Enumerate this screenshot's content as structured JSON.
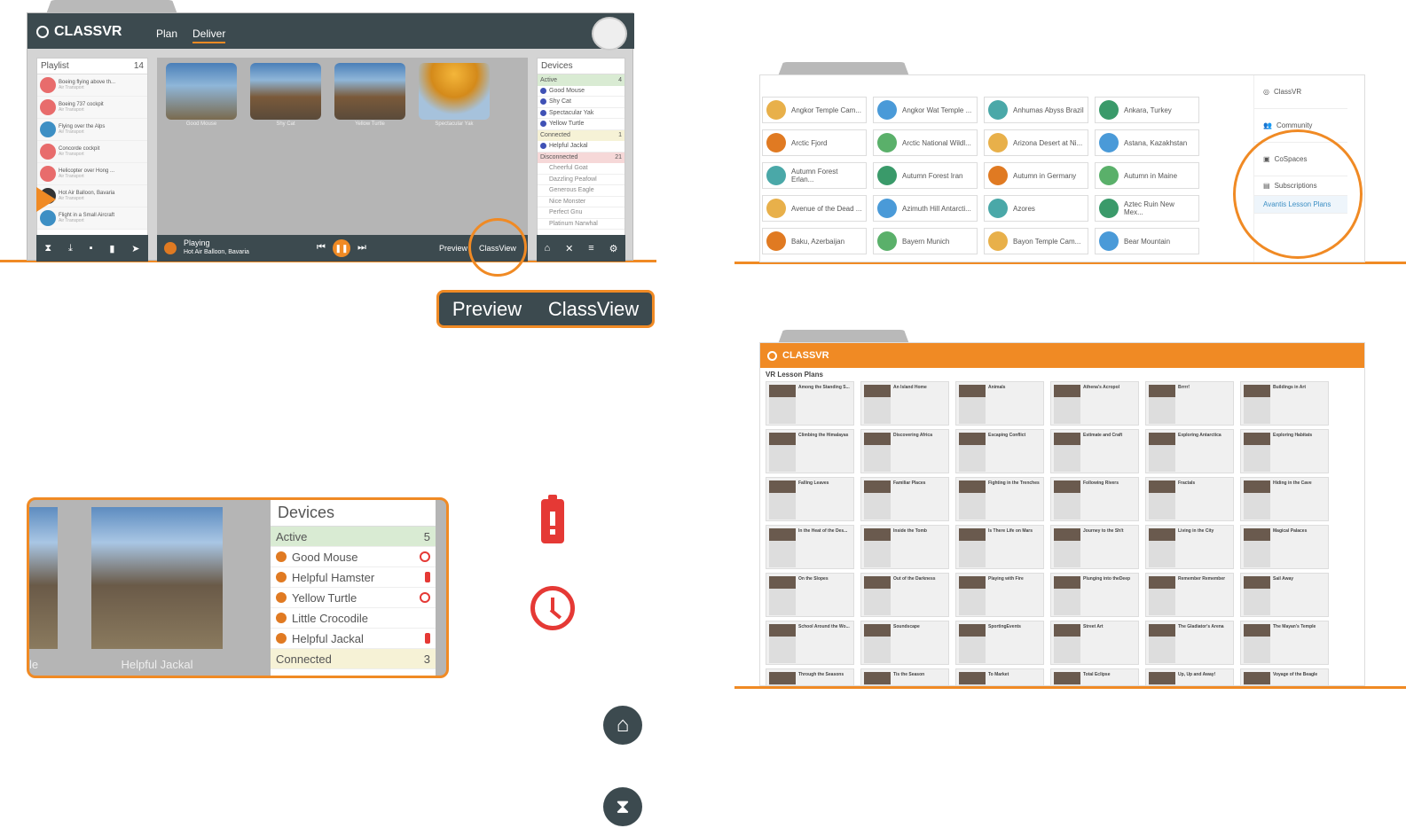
{
  "app": {
    "brand": "CLASSVR",
    "nav": [
      "Plan",
      "Deliver"
    ],
    "accent": "#f08a24",
    "dark": "#3c4a4f"
  },
  "playlist": {
    "title": "Playlist",
    "count": "14",
    "items": [
      {
        "title": "Boeing flying above th...",
        "sub": "Air Transport"
      },
      {
        "title": "Boeing 737 cockpit",
        "sub": "Air Transport"
      },
      {
        "title": "Flying over the Alps",
        "sub": "Air Transport"
      },
      {
        "title": "Concorde cockpit",
        "sub": "Air Transport"
      },
      {
        "title": "Helicopter over Hong ...",
        "sub": "Air Transport"
      },
      {
        "title": "Hot Air Balloon, Bavaria",
        "sub": "Air Transport"
      },
      {
        "title": "Flight in a Small Aircraft",
        "sub": "Air Transport"
      }
    ],
    "toolbar_icons": [
      "hourglass-icon",
      "download-icon",
      "save-icon",
      "trash-icon",
      "send-icon"
    ]
  },
  "stage": {
    "thumbs": [
      "Good Mouse",
      "Shy Cat",
      "Yellow Turtle",
      "Spectacular Yak"
    ],
    "status": "Playing",
    "now_playing": "Hot Air Balloon, Bavaria",
    "preview_label": "Preview",
    "classview_label": "ClassView"
  },
  "devices": {
    "title": "Devices",
    "active_label": "Active",
    "active_count": "4",
    "active": [
      "Good Mouse",
      "Shy Cat",
      "Spectacular Yak",
      "Yellow Turtle"
    ],
    "connected_label": "Connected",
    "connected_count": "1",
    "connected": [
      "Helpful Jackal"
    ],
    "disconnected_label": "Disconnected",
    "disconnected_count": "21",
    "disconnected": [
      "Cheerful Goat",
      "Dazzling Peafowl",
      "Generous Eagle",
      "Nice Monster",
      "Perfect Gnu",
      "Platinum Narwhal"
    ]
  },
  "zoom": {
    "thumb_partial": "le",
    "thumb_label": "Helpful Jackal",
    "devices_title": "Devices",
    "active_label": "Active",
    "active_count": "5",
    "rows": [
      {
        "name": "Good Mouse",
        "icon": "alarm"
      },
      {
        "name": "Helpful Hamster",
        "icon": "battery"
      },
      {
        "name": "Yellow Turtle",
        "icon": "alarm"
      },
      {
        "name": "Little Crocodile",
        "icon": ""
      },
      {
        "name": "Helpful Jackal",
        "icon": "battery"
      }
    ],
    "connected_label": "Connected",
    "connected_count": "3"
  },
  "library": {
    "tiles": [
      [
        "Angkor Temple Cam...",
        "Angkor Wat Temple ...",
        "Anhumas Abyss Brazil",
        "Ankara, Turkey"
      ],
      [
        "Arctic Fjord",
        "Arctic National Wildl...",
        "Arizona Desert at Ni...",
        "Astana, Kazakhstan"
      ],
      [
        "Autumn Forest Erlan...",
        "Autumn Forest Iran",
        "Autumn in Germany",
        "Autumn in Maine"
      ],
      [
        "Avenue of the Dead ...",
        "Azimuth Hill Antarcti...",
        "Azores",
        "Aztec Ruin New Mex..."
      ],
      [
        "Baku, Azerbaijan",
        "Bayern Munich",
        "Bayon Temple Cam...",
        "Bear Mountain"
      ]
    ],
    "side": [
      "ClassVR",
      "Community",
      "CoSpaces",
      "Subscriptions",
      "Avantis Lesson Plans"
    ]
  },
  "lessons": {
    "brand": "CLASSVR",
    "heading": "VR Lesson Plans",
    "cards": [
      "Among the Standing S...",
      "An Island Home",
      "Animals",
      "Athena's Acropol",
      "Brrrr!",
      "Buildings in Art",
      "Climbing the Himalayas",
      "Discovering Africa",
      "Escaping Conflict",
      "Estimate and Craft",
      "Exploring Antarctica",
      "Exploring Habitats",
      "Falling Leaves",
      "Familiar Places",
      "Fighting in the Trenches",
      "Following Rivers",
      "Fractals",
      "Hiding in the Cave",
      "In the Heat of the Des...",
      "Inside the Tomb",
      "Is There Life on Mars",
      "Journey to the Sh!t",
      "Living in the City",
      "Magical Palaces",
      "On the Slopes",
      "Out of the Darkness",
      "Playing with Fire",
      "Plunging into theDeep",
      "Remember Remember",
      "Sail Away",
      "School Around the Wo...",
      "Soundscape",
      "SportingEvents",
      "Street Art",
      "The Gladiator's Arena",
      "The Mayan's Temple",
      "Through the Seasons",
      "Tis the Season",
      "To Market",
      "Total Eclipse",
      "Up, Up and Away!",
      "Voyage of the Beagle"
    ]
  }
}
